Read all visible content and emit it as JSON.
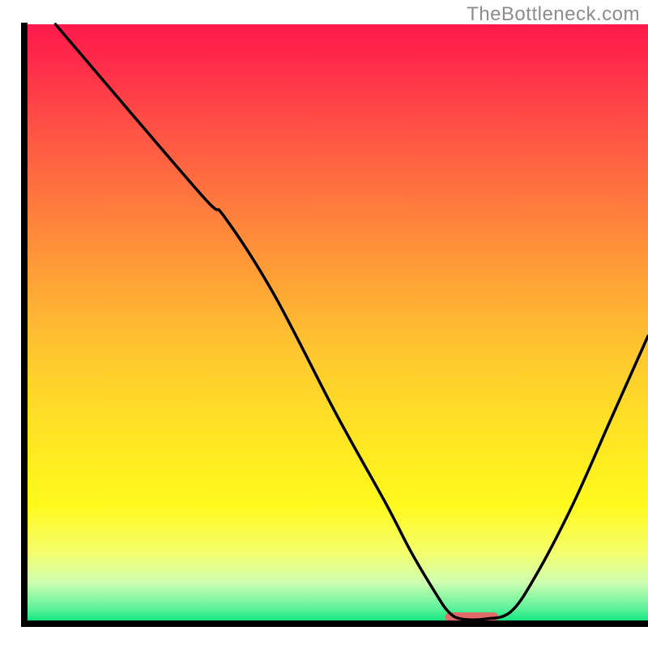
{
  "watermark": "TheBottleneck.com",
  "chart_data": {
    "type": "line",
    "title": "",
    "xlabel": "",
    "ylabel": "",
    "xlim": [
      0,
      100
    ],
    "ylim": [
      0,
      100
    ],
    "grid": false,
    "curve_points_xy": [
      [
        5,
        100
      ],
      [
        28,
        72
      ],
      [
        32,
        68
      ],
      [
        40,
        55
      ],
      [
        50,
        35
      ],
      [
        58,
        20
      ],
      [
        62,
        12
      ],
      [
        66,
        5
      ],
      [
        68,
        2
      ],
      [
        70,
        0.8
      ],
      [
        74,
        0.8
      ],
      [
        78,
        2
      ],
      [
        82,
        8
      ],
      [
        88,
        20
      ],
      [
        94,
        34
      ],
      [
        100,
        48
      ]
    ],
    "sweet_spot_x_range": [
      67.5,
      76
    ],
    "gradient_stops": [
      {
        "offset": 0.0,
        "color": "#ff1a4b"
      },
      {
        "offset": 0.06,
        "color": "#ff2a4a"
      },
      {
        "offset": 0.15,
        "color": "#ff4a46"
      },
      {
        "offset": 0.25,
        "color": "#ff6a40"
      },
      {
        "offset": 0.4,
        "color": "#ff9a38"
      },
      {
        "offset": 0.55,
        "color": "#ffc82e"
      },
      {
        "offset": 0.68,
        "color": "#ffe424"
      },
      {
        "offset": 0.8,
        "color": "#fff91c"
      },
      {
        "offset": 0.88,
        "color": "#f5ff6a"
      },
      {
        "offset": 0.93,
        "color": "#d0ffb0"
      },
      {
        "offset": 0.975,
        "color": "#5cf29a"
      },
      {
        "offset": 1.0,
        "color": "#00e47a"
      }
    ],
    "colors": {
      "axis": "#000000",
      "curve": "#000000",
      "sweet_spot_fill": "#e06a6a"
    }
  }
}
